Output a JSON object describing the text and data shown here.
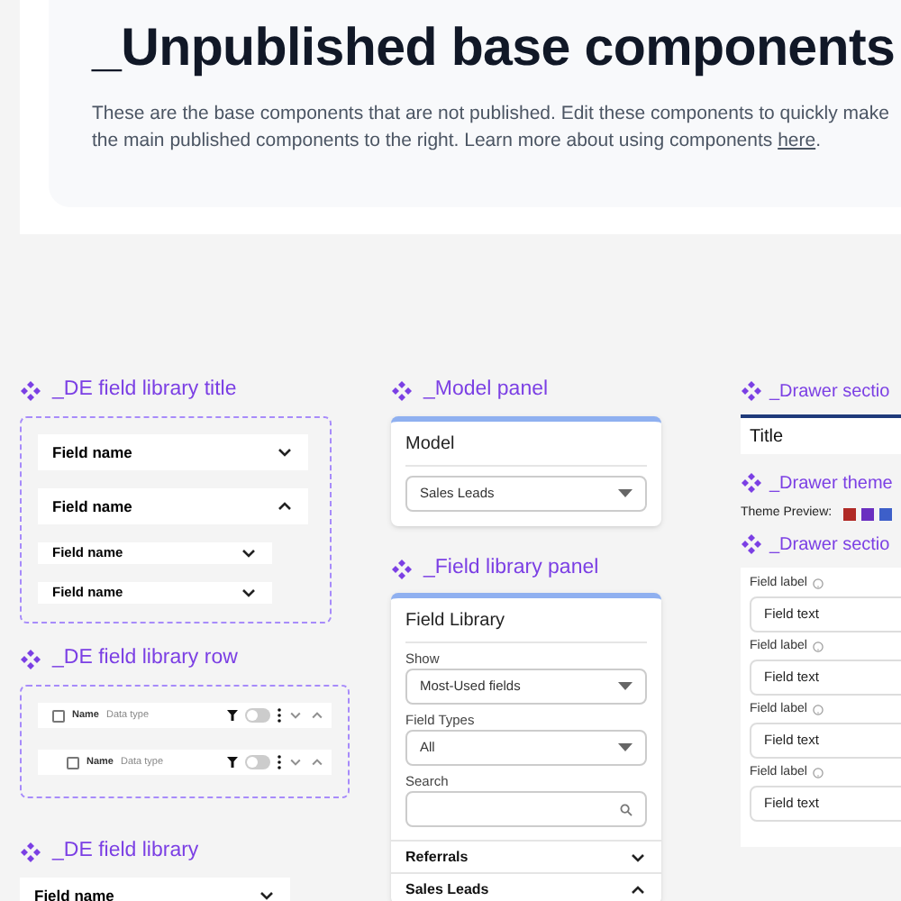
{
  "header": {
    "title": "_Unpublished base components",
    "lines": [
      "These are the base components that are not published. Edit these components to quickly make",
      "the main published components to the right. Learn more about using components "
    ],
    "link": "here",
    "after_link": "."
  },
  "title_section": {
    "heading": "_DE field library title",
    "rows": [
      {
        "label": "Field name",
        "kind": "large",
        "expanded": false
      },
      {
        "label": "Field name",
        "kind": "large",
        "expanded": true
      },
      {
        "label": "Field name",
        "kind": "small",
        "expanded": false
      },
      {
        "label": "Field name",
        "kind": "small",
        "expanded": false
      }
    ]
  },
  "row_section": {
    "heading": "_DE field library row",
    "rows": [
      {
        "name": "Name",
        "type": "Data type",
        "indented": false,
        "checked": false,
        "on": false
      },
      {
        "name": "Name",
        "type": "Data type",
        "indented": true,
        "checked": false,
        "on": false
      }
    ]
  },
  "library_section": {
    "heading": "_DE field library",
    "rows": [
      {
        "label": "Field name",
        "expanded": false
      }
    ]
  },
  "model_panel": {
    "heading": "_Model panel",
    "title": "Model",
    "select": "Sales Leads"
  },
  "field_panel": {
    "heading": "_Field library panel",
    "title": "Field Library",
    "filters": [
      {
        "label": "Show",
        "kind": "select",
        "value": "Most-Used fields"
      },
      {
        "label": "Field Types",
        "kind": "select",
        "value": "All"
      },
      {
        "label": "Search",
        "kind": "search"
      }
    ],
    "groups": [
      {
        "label": "Referrals",
        "expanded": false
      },
      {
        "label": "Sales Leads",
        "expanded": true
      }
    ]
  },
  "drawer_title": {
    "heading": "_Drawer sectio",
    "title": "Title"
  },
  "drawer_theme": {
    "heading": "_Drawer theme",
    "label": "Theme Preview:",
    "swatches": [
      {
        "color": "#b02a26"
      },
      {
        "color": "#6a2fc0"
      },
      {
        "color": "#3d5fc9"
      }
    ]
  },
  "drawer_fields": {
    "heading": "_Drawer sectio",
    "fields": [
      {
        "label": "Field label",
        "value": "Field text"
      },
      {
        "label": "Field label",
        "value": "Field text"
      },
      {
        "label": "Field label",
        "value": "Field text"
      },
      {
        "label": "Field label",
        "value": "Field text"
      }
    ]
  }
}
